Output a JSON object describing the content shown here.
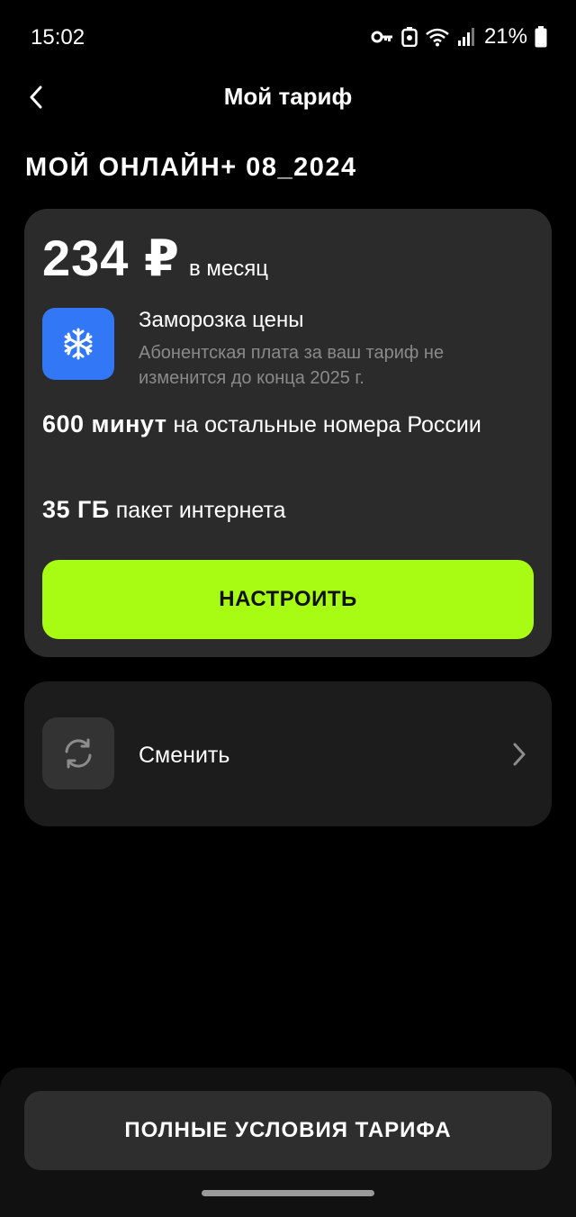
{
  "status_bar": {
    "time": "15:02",
    "battery": "21%",
    "icons": [
      "key-icon",
      "nfc-icon",
      "wifi-icon",
      "signal-icon",
      "battery-icon"
    ]
  },
  "nav": {
    "title": "Мой тариф",
    "back_icon": "chevron-left-icon"
  },
  "tariff": {
    "name": "МОЙ ОНЛАЙН+ 08_2024",
    "price": "234 ₽",
    "period": "в месяц",
    "freeze": {
      "icon": "snowflake-icon",
      "title": "Заморозка цены",
      "description": "Абонентская плата за ваш тариф не изменится до конца 2025 г."
    },
    "minutes": {
      "value": "600 минут",
      "text": " на остальные номера России"
    },
    "internet": {
      "value": "35 ГБ",
      "text": " пакет интернета"
    },
    "configure_label": "НАСТРОИТЬ"
  },
  "change": {
    "icon": "refresh-icon",
    "label": "Сменить"
  },
  "footer": {
    "full_terms_label": "ПОЛНЫЕ УСЛОВИЯ ТАРИФА"
  },
  "colors": {
    "background": "#000000",
    "card": "#2b2b2b",
    "accent": "#a8fc14",
    "freeze_blue": "#3278f6",
    "muted_text": "#8a8a8a"
  }
}
